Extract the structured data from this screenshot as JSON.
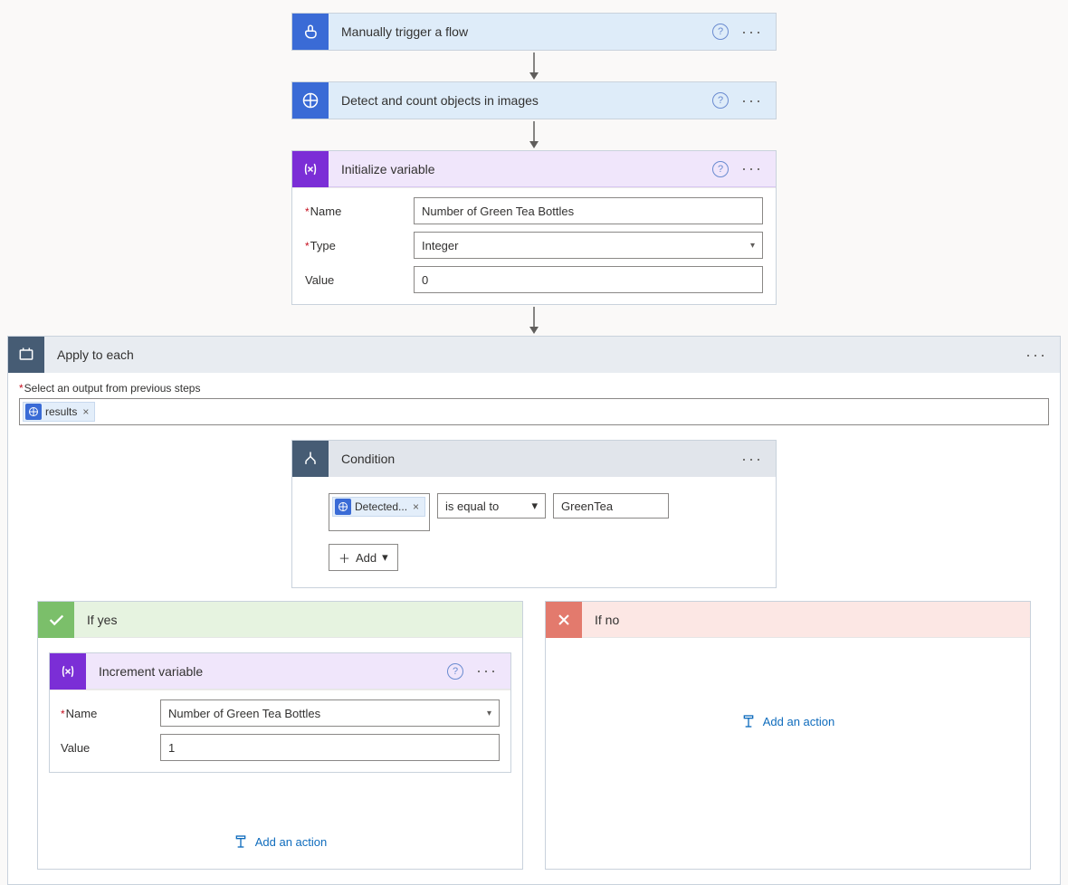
{
  "steps": {
    "trigger": {
      "title": "Manually trigger a flow"
    },
    "detect": {
      "title": "Detect and count objects in images"
    },
    "initVar": {
      "title": "Initialize variable",
      "fields": {
        "name_label": "Name",
        "name_value": "Number of Green Tea Bottles",
        "type_label": "Type",
        "type_value": "Integer",
        "value_label": "Value",
        "value_value": "0"
      }
    }
  },
  "apply": {
    "title": "Apply to each",
    "output_label": "Select an output from previous steps",
    "token": "results"
  },
  "condition": {
    "title": "Condition",
    "left_token": "Detected...",
    "operator": "is equal to",
    "right_value": "GreenTea",
    "add_label": "Add"
  },
  "yes": {
    "title": "If yes",
    "increment": {
      "title": "Increment variable",
      "name_label": "Name",
      "name_value": "Number of Green Tea Bottles",
      "value_label": "Value",
      "value_value": "1"
    },
    "add_action": "Add an action"
  },
  "no": {
    "title": "If no",
    "add_action": "Add an action"
  }
}
